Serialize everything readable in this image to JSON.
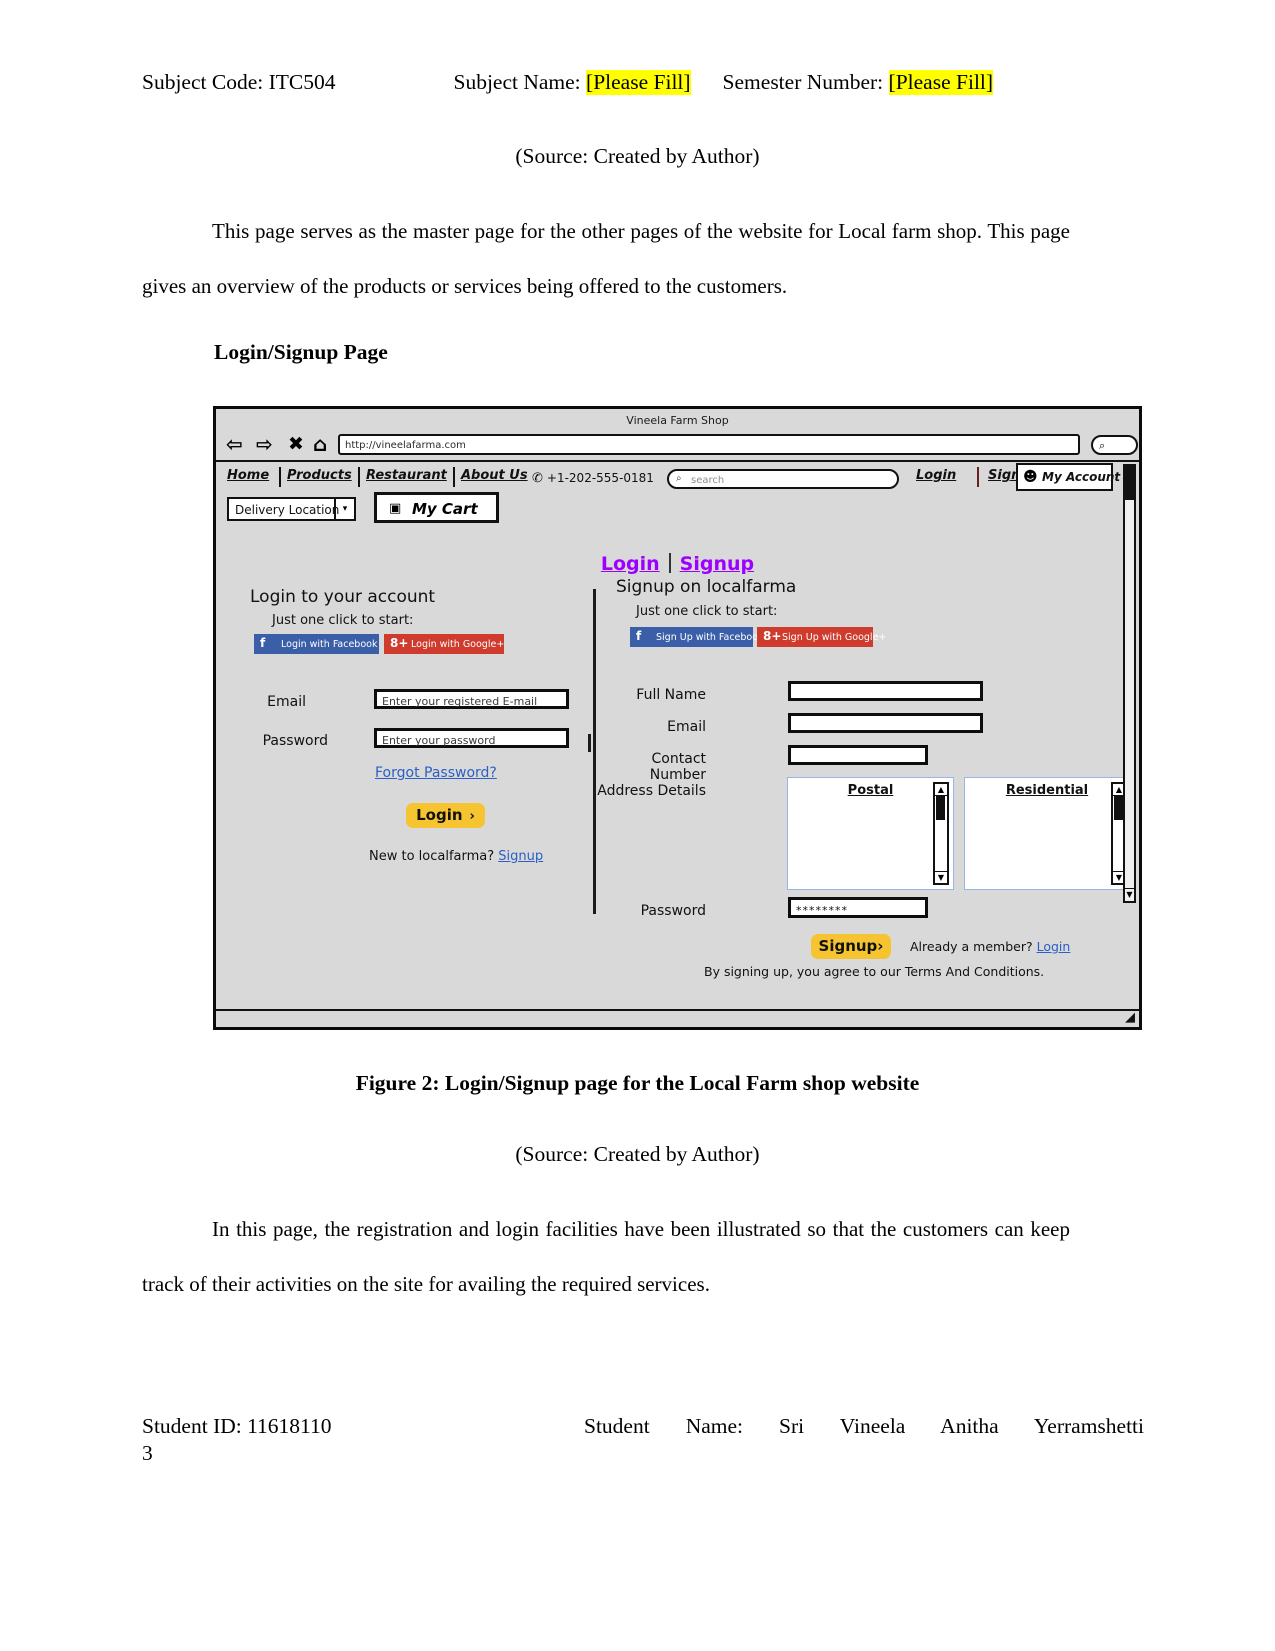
{
  "doc": {
    "header": {
      "subject_code_label": "Subject Code: ITC504",
      "subject_name_label": "Subject Name:",
      "subject_name_value": "[Please Fill]",
      "semester_label": "Semester Number:",
      "semester_value": "[Please Fill]"
    },
    "source_note_1": "(Source: Created by Author)",
    "paragraph_1": "This page serves as the master page for the other pages of the website for Local farm shop. This page gives an overview of the products or services being offered to the customers.",
    "section_title": "Login/Signup Page",
    "figure_caption": "Figure 2: Login/Signup page for the Local Farm shop website",
    "source_note_2": "(Source: Created by Author)",
    "paragraph_2": "In this page, the registration and login facilities have been illustrated so that the customers can keep track of their activities on the site for availing the required services.",
    "footer": {
      "student_id": "Student ID: 11618110",
      "student_id_overflow": "3",
      "student_name": "Student Name: Sri Vineela Anitha Yerramshetti"
    }
  },
  "wireframe": {
    "browser": {
      "title": "Vineela Farm Shop",
      "url": "http://vineelafarma.com",
      "back_icon": "⇦",
      "forward_icon": "⇨",
      "stop_icon": "✖",
      "home_icon": "⌂",
      "search_icon": "⌕"
    },
    "nav": {
      "items": [
        "Home",
        "Products",
        "Restaurant",
        "About Us"
      ],
      "phone_icon": "✆",
      "phone": "+1-202-555-0181",
      "search_placeholder": "search",
      "search_icon": "⌕",
      "login": "Login",
      "signup": "Signup",
      "my_account": "My Account",
      "account_icon": "☻",
      "delivery_location": "Delivery Location",
      "delivery_arrow": "▾",
      "my_cart": "My Cart",
      "cart_icon": "▣"
    },
    "tabs": {
      "login": "Login",
      "signup": "Signup"
    },
    "login_panel": {
      "title": "Login to your account",
      "subtitle": "Just one click to start:",
      "facebook_button": "Login with Facebook",
      "facebook_glyph": "f",
      "google_button": "Login with Google+",
      "google_glyph": "8+",
      "email_label": "Email",
      "email_placeholder": "Enter your registered E-mail",
      "password_label": "Password",
      "password_placeholder": "Enter your password",
      "forgot_password": "Forgot Password?",
      "login_button": "Login",
      "login_button_arrow": "›",
      "new_user_text": "New to localfarma?",
      "new_user_link": "Signup"
    },
    "signup_panel": {
      "title": "Signup on localfarma",
      "subtitle": "Just one click to start:",
      "facebook_button": "Sign Up with Facebook",
      "facebook_glyph": "f",
      "google_button": "Sign Up with Google+",
      "google_glyph": "8+",
      "full_name_label": "Full Name",
      "full_name_value": "",
      "email_label": "Email",
      "email_value": "",
      "contact_label": "Contact Number",
      "contact_value": "",
      "address_label": "Address Details",
      "address_postal_title": "Postal",
      "address_residential_title": "Residential",
      "password_label": "Password",
      "password_value": "********",
      "signup_button": "Signup",
      "signup_button_arrow": "›",
      "already_member_text": "Already a member?",
      "already_member_link": "Login",
      "terms_text": "By signing up, you agree to our Terms And Conditions.",
      "scroll_up_icon": "▲",
      "scroll_down_icon": "▼"
    },
    "colors": {
      "tab_accent": "#9d00ff",
      "facebook": "#3a5fa8",
      "google": "#cf3b2d",
      "button_yellow": "#f5c430",
      "link_blue": "#2b5fc4",
      "highlight_yellow": "#ffff00",
      "chrome_gray": "#d9d9d9"
    }
  }
}
